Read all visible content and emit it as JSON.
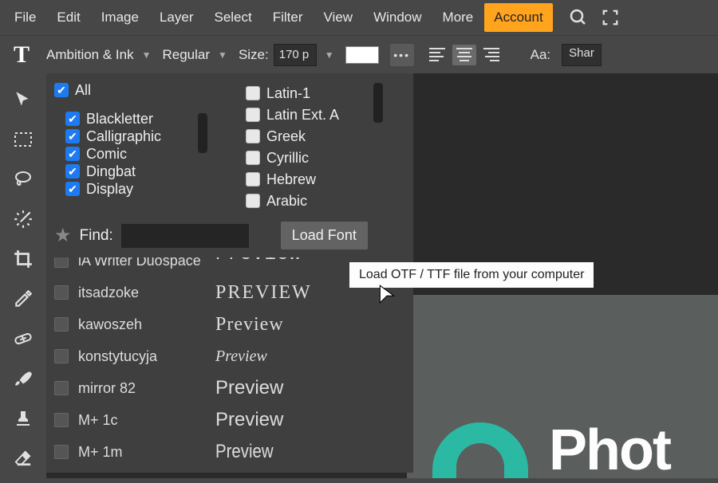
{
  "menu": {
    "items": [
      "File",
      "Edit",
      "Image",
      "Layer",
      "Select",
      "Filter",
      "View",
      "Window",
      "More"
    ],
    "account": "Account"
  },
  "options": {
    "font_family": "Ambition & Ink",
    "font_style": "Regular",
    "size_label": "Size:",
    "size_value": "170 p",
    "aa_label": "Aa:",
    "aa_value": "Shar"
  },
  "filters": {
    "all": "All",
    "col1": [
      {
        "label": "Blackletter",
        "checked": true
      },
      {
        "label": "Calligraphic",
        "checked": true
      },
      {
        "label": "Comic",
        "checked": true
      },
      {
        "label": "Dingbat",
        "checked": true
      },
      {
        "label": "Display",
        "checked": true
      }
    ],
    "col2": [
      {
        "label": "Latin-1",
        "checked": false
      },
      {
        "label": "Latin Ext. A",
        "checked": false
      },
      {
        "label": "Greek",
        "checked": false
      },
      {
        "label": "Cyrillic",
        "checked": false
      },
      {
        "label": "Hebrew",
        "checked": false
      },
      {
        "label": "Arabic",
        "checked": false
      }
    ]
  },
  "find": {
    "label": "Find:",
    "value": "",
    "load_btn": "Load Font"
  },
  "fonts": [
    {
      "name": "iA Writer Duospace",
      "preview": "Preview",
      "cls": "prev-mono cut-top"
    },
    {
      "name": "itsadzoke",
      "preview": "PREVIEW",
      "cls": "prev-sc"
    },
    {
      "name": "kawoszeh",
      "preview": "Preview",
      "cls": "prev-serif"
    },
    {
      "name": "konstytucyja",
      "preview": "Preview",
      "cls": "prev-script"
    },
    {
      "name": "mirror 82",
      "preview": "Preview",
      "cls": "prev-plain"
    },
    {
      "name": "M+ 1c",
      "preview": "Preview",
      "cls": "prev-plain"
    },
    {
      "name": "M+ 1m",
      "preview": "Preview",
      "cls": "prev-cond"
    }
  ],
  "tooltip": "Load OTF / TTF file from your computer",
  "logo_text": "Phot"
}
